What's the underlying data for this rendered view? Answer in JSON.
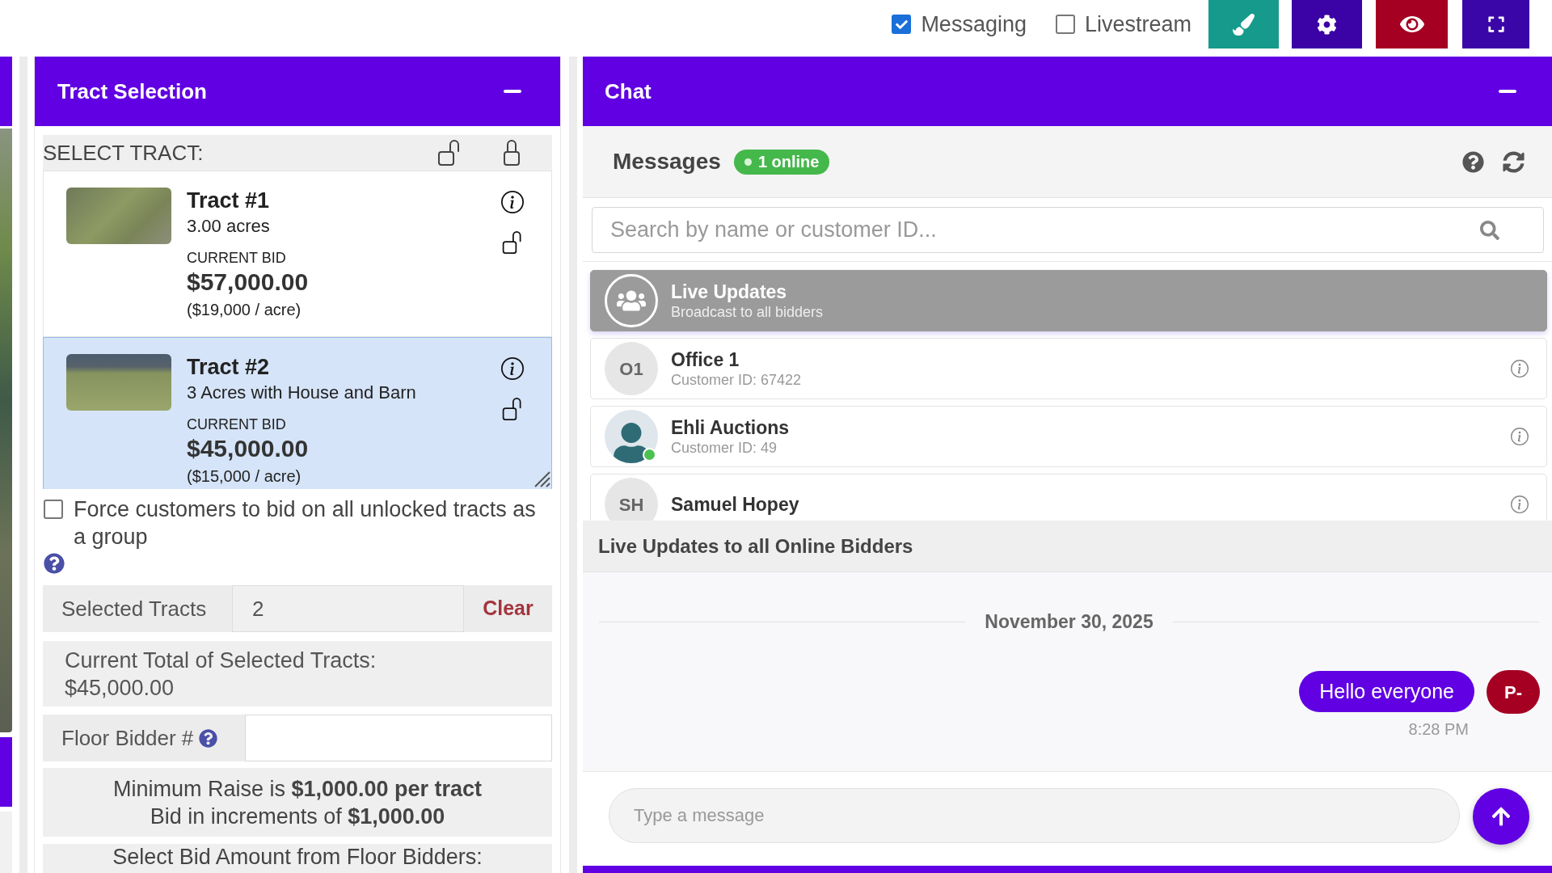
{
  "toolbar": {
    "toggles": [
      {
        "label": "Messaging",
        "checked": true
      },
      {
        "label": "Livestream",
        "checked": false
      }
    ]
  },
  "tract_panel": {
    "title": "Tract Selection",
    "select_label": "SELECT TRACT:",
    "tracts": [
      {
        "title": "Tract #1",
        "description": "3.00 acres",
        "bid_label": "CURRENT BID",
        "bid": "$57,000.00",
        "per_acre": "($19,000 / acre)",
        "locked": false,
        "selected": false
      },
      {
        "title": "Tract #2",
        "description": "3 Acres with House and Barn",
        "bid_label": "CURRENT BID",
        "bid": "$45,000.00",
        "per_acre": "($15,000 / acre)",
        "locked": false,
        "selected": true
      }
    ],
    "group_option": {
      "label": "Force customers to bid on all unlocked tracts as a group",
      "checked": false
    },
    "selected_tracts": {
      "label": "Selected Tracts",
      "value": "2",
      "action": "Clear"
    },
    "total": {
      "label": "Current Total of Selected Tracts:",
      "value": "$45,000.00"
    },
    "floor_bidder": {
      "label": "Floor Bidder #"
    },
    "raise_info": [
      "Minimum Raise is **$1,000.00 per tract**",
      "Bid in increments of **$1,000.00**"
    ],
    "bid_select_label": "Select Bid Amount from Floor Bidders:"
  },
  "chat_panel": {
    "title": "Chat",
    "messages_title": "Messages",
    "online_badge": "1 online",
    "search": {
      "placeholder": "Search by name or customer ID..."
    },
    "contacts": [
      {
        "kind": "broadcast",
        "name": "Live Updates",
        "subtitle": "Broadcast to all bidders",
        "online": false,
        "selected": true
      },
      {
        "kind": "initials",
        "initials": "O1",
        "name": "Office 1",
        "subtitle": "Customer ID: 67422",
        "online": false,
        "selected": false
      },
      {
        "kind": "photo",
        "name": "Ehli Auctions",
        "subtitle": "Customer ID: 49",
        "online": true,
        "selected": false
      },
      {
        "kind": "initials",
        "initials": "SH",
        "name": "Samuel Hopey",
        "online": false,
        "selected": false
      }
    ],
    "conversation_title": "Live Updates to all Online Bidders",
    "date": "November 30, 2025",
    "messages": [
      {
        "text": "Hello everyone",
        "time": "8:28 PM",
        "sender": "P-"
      }
    ],
    "composer": {
      "placeholder": "Type a message"
    }
  }
}
